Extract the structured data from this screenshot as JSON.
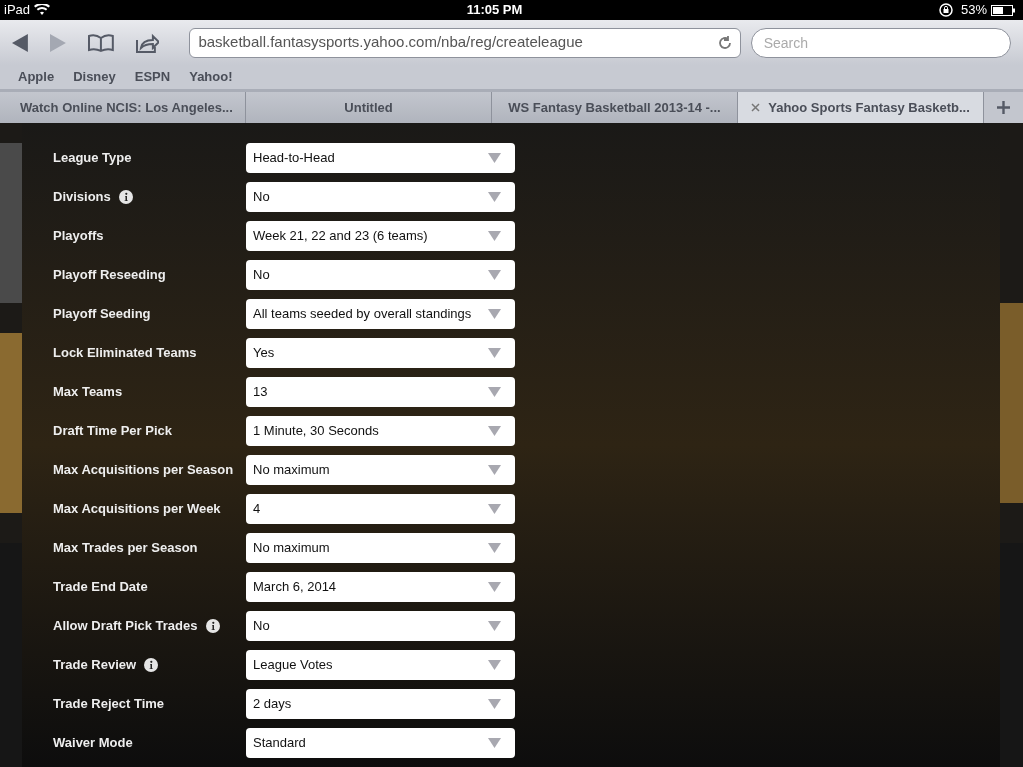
{
  "status_bar": {
    "device": "iPad",
    "time": "11:05 PM",
    "battery": "53%"
  },
  "toolbar": {
    "url": "basketball.fantasysports.yahoo.com/nba/reg/createleague",
    "search_placeholder": "Search"
  },
  "bookmarks": [
    "Apple",
    "Disney",
    "ESPN",
    "Yahoo!"
  ],
  "tabs": [
    {
      "title": "Watch Online NCIS: Los Angeles...",
      "selected": false
    },
    {
      "title": "Untitled",
      "selected": false
    },
    {
      "title": "WS Fantasy Basketball 2013-14 -...",
      "selected": false
    },
    {
      "title": "Yahoo Sports Fantasy Basketb...",
      "selected": true
    }
  ],
  "settings": [
    {
      "label": "League Type",
      "info": false,
      "value": "Head-to-Head"
    },
    {
      "label": "Divisions",
      "info": true,
      "value": "No"
    },
    {
      "label": "Playoffs",
      "info": false,
      "value": "Week 21, 22 and 23 (6 teams)"
    },
    {
      "label": "Playoff Reseeding",
      "info": false,
      "value": "No"
    },
    {
      "label": "Playoff Seeding",
      "info": false,
      "value": "All teams seeded by overall standings"
    },
    {
      "label": "Lock Eliminated Teams",
      "info": false,
      "value": "Yes"
    },
    {
      "label": "Max Teams",
      "info": false,
      "value": "13"
    },
    {
      "label": "Draft Time Per Pick",
      "info": false,
      "value": "1 Minute, 30 Seconds"
    },
    {
      "label": "Max Acquisitions per Season",
      "info": false,
      "value": "No maximum"
    },
    {
      "label": "Max Acquisitions per Week",
      "info": false,
      "value": "4"
    },
    {
      "label": "Max Trades per Season",
      "info": false,
      "value": "No maximum"
    },
    {
      "label": "Trade End Date",
      "info": false,
      "value": "March 6, 2014"
    },
    {
      "label": "Allow Draft Pick Trades",
      "info": true,
      "value": "No"
    },
    {
      "label": "Trade Review",
      "info": true,
      "value": "League Votes"
    },
    {
      "label": "Trade Reject Time",
      "info": false,
      "value": "2 days"
    },
    {
      "label": "Waiver Mode",
      "info": false,
      "value": "Standard"
    }
  ]
}
